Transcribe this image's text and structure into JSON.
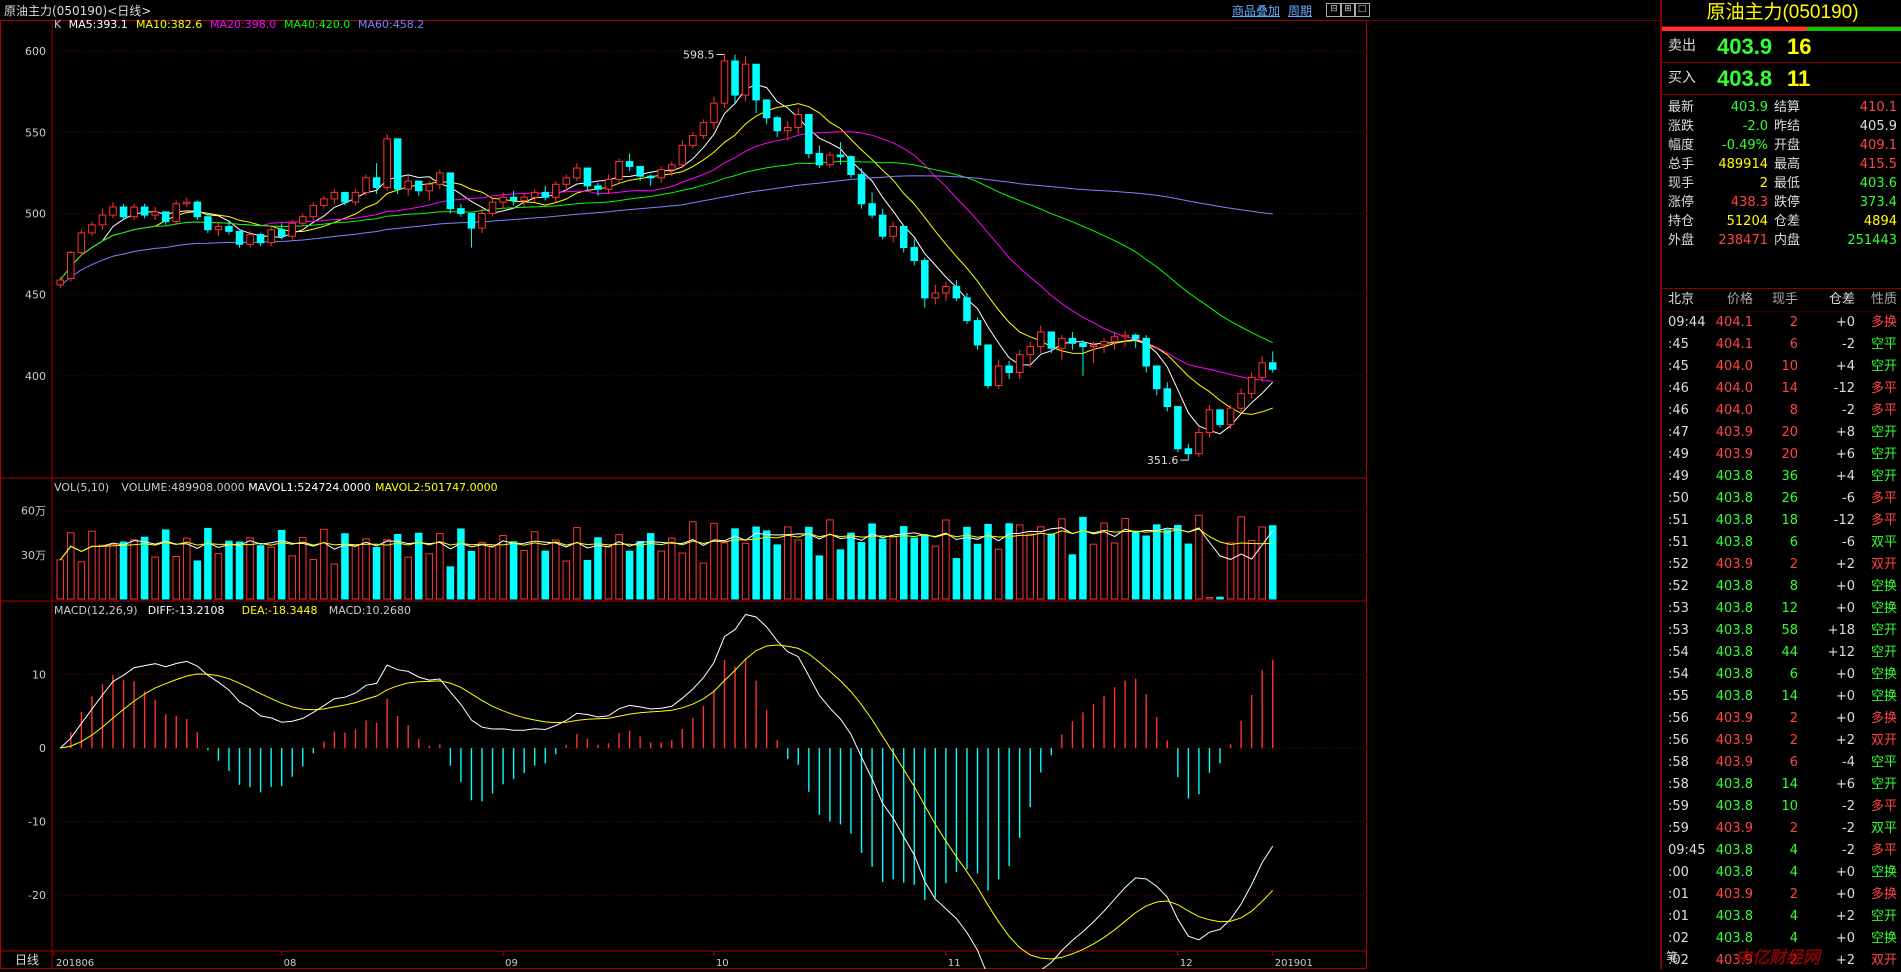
{
  "window": {
    "title": "原油主力(050190)<日线>",
    "links": [
      "商品叠加",
      "周期"
    ],
    "buttons": [
      "⊟",
      "⊞",
      "□"
    ]
  },
  "main_chart": {
    "legend": [
      {
        "label": "K",
        "color": "#cccccc"
      },
      {
        "label": "MA5:393.1",
        "color": "#ffffff"
      },
      {
        "label": "MA10:382.6",
        "color": "#ffff00"
      },
      {
        "label": "MA20:398.0",
        "color": "#ff00ff"
      },
      {
        "label": "MA40:420.0",
        "color": "#00ff00"
      },
      {
        "label": "MA60:458.2",
        "color": "#8080ff"
      }
    ],
    "yticks": [
      "600",
      "550",
      "500",
      "450",
      "400"
    ],
    "high_label": "598.5",
    "low_label": "351.6"
  },
  "volume_chart": {
    "legend": [
      {
        "label": "VOL(5,10)",
        "color": "#cccccc"
      },
      {
        "label": "VOLUME:489908.0000",
        "color": "#cccccc"
      },
      {
        "label": "MAVOL1:524724.0000",
        "color": "#ffffff"
      },
      {
        "label": "MAVOL2:501747.0000",
        "color": "#ffff00"
      }
    ],
    "yticks": [
      "60万",
      "30万"
    ]
  },
  "macd_chart": {
    "legend": [
      {
        "label": "MACD(12,26,9)",
        "color": "#cccccc"
      },
      {
        "label": "DIFF:-13.2108",
        "color": "#ffffff"
      },
      {
        "label": "DEA:-18.3448",
        "color": "#ffff00"
      },
      {
        "label": "MACD:10.2680",
        "color": "#cccccc"
      }
    ],
    "yticks": [
      "10",
      "0",
      "-10",
      "-20"
    ]
  },
  "x_axis": {
    "period_label": "日线",
    "labels": [
      "201806",
      "08",
      "09",
      "10",
      "11",
      "12",
      "201901"
    ]
  },
  "chart_data": {
    "type": "candlestick",
    "title": "原油主力(050190) 日线",
    "ylim": [
      345,
      610
    ],
    "candles": [
      [
        456,
        461,
        454,
        459
      ],
      [
        460,
        477,
        458,
        476
      ],
      [
        476,
        490,
        474,
        488
      ],
      [
        488,
        495,
        486,
        493
      ],
      [
        493,
        503,
        490,
        499
      ],
      [
        499,
        507,
        497,
        504
      ],
      [
        504,
        506,
        496,
        498
      ],
      [
        498,
        506,
        496,
        504
      ],
      [
        504,
        506,
        497,
        499
      ],
      [
        499,
        504,
        496,
        501
      ],
      [
        501,
        501,
        493,
        495
      ],
      [
        495,
        508,
        493,
        506
      ],
      [
        506,
        510,
        504,
        507
      ],
      [
        507,
        508,
        496,
        498
      ],
      [
        498,
        500,
        488,
        490
      ],
      [
        490,
        494,
        486,
        492
      ],
      [
        492,
        496,
        487,
        489
      ],
      [
        489,
        489,
        479,
        481
      ],
      [
        481,
        489,
        479,
        487
      ],
      [
        487,
        488,
        480,
        482
      ],
      [
        482,
        492,
        480,
        490
      ],
      [
        490,
        494,
        484,
        486
      ],
      [
        486,
        496,
        484,
        494
      ],
      [
        494,
        500,
        492,
        498
      ],
      [
        498,
        507,
        496,
        505
      ],
      [
        505,
        511,
        503,
        509
      ],
      [
        509,
        515,
        506,
        513
      ],
      [
        513,
        510,
        505,
        507
      ],
      [
        507,
        515,
        505,
        513
      ],
      [
        513,
        524,
        511,
        522
      ],
      [
        522,
        531,
        512,
        516
      ],
      [
        516,
        549,
        514,
        546
      ],
      [
        546,
        528,
        512,
        515
      ],
      [
        515,
        523,
        511,
        520
      ],
      [
        520,
        519,
        511,
        514
      ],
      [
        514,
        520,
        508,
        518
      ],
      [
        518,
        527,
        515,
        525
      ],
      [
        525,
        515,
        500,
        503
      ],
      [
        503,
        506,
        498,
        500
      ],
      [
        500,
        497,
        479,
        491
      ],
      [
        491,
        503,
        488,
        500
      ],
      [
        500,
        509,
        498,
        507
      ],
      [
        507,
        513,
        503,
        510
      ],
      [
        510,
        514,
        505,
        508
      ],
      [
        508,
        512,
        504,
        510
      ],
      [
        510,
        515,
        507,
        513
      ],
      [
        513,
        517,
        508,
        510
      ],
      [
        510,
        520,
        507,
        518
      ],
      [
        518,
        524,
        514,
        522
      ],
      [
        522,
        531,
        520,
        528
      ],
      [
        528,
        522,
        514,
        517
      ],
      [
        517,
        519,
        511,
        515
      ],
      [
        515,
        524,
        512,
        521
      ],
      [
        521,
        534,
        519,
        532
      ],
      [
        532,
        537,
        526,
        529
      ],
      [
        529,
        528,
        520,
        523
      ],
      [
        523,
        524,
        517,
        522
      ],
      [
        522,
        529,
        519,
        527
      ],
      [
        527,
        532,
        523,
        530
      ],
      [
        530,
        545,
        528,
        542
      ],
      [
        542,
        550,
        540,
        548
      ],
      [
        548,
        558,
        546,
        556
      ],
      [
        556,
        572,
        552,
        568
      ],
      [
        568,
        598,
        565,
        594
      ],
      [
        594,
        598,
        568,
        573
      ],
      [
        573,
        597,
        569,
        592
      ],
      [
        592,
        592,
        562,
        570
      ],
      [
        570,
        568,
        555,
        559
      ],
      [
        559,
        560,
        547,
        551
      ],
      [
        551,
        557,
        545,
        553
      ],
      [
        553,
        565,
        549,
        561
      ],
      [
        561,
        558,
        534,
        537
      ],
      [
        537,
        542,
        528,
        530
      ],
      [
        530,
        538,
        528,
        536
      ],
      [
        536,
        544,
        530,
        535
      ],
      [
        535,
        536,
        522,
        524
      ],
      [
        524,
        528,
        503,
        506
      ],
      [
        506,
        513,
        497,
        499
      ],
      [
        499,
        503,
        484,
        486
      ],
      [
        486,
        495,
        482,
        492
      ],
      [
        492,
        491,
        476,
        479
      ],
      [
        479,
        484,
        468,
        471
      ],
      [
        471,
        473,
        442,
        448
      ],
      [
        448,
        456,
        444,
        451
      ],
      [
        451,
        458,
        446,
        455
      ],
      [
        455,
        459,
        446,
        448
      ],
      [
        448,
        451,
        432,
        434
      ],
      [
        434,
        436,
        416,
        419
      ],
      [
        419,
        419,
        392,
        394
      ],
      [
        394,
        410,
        392,
        406
      ],
      [
        406,
        409,
        398,
        402
      ],
      [
        402,
        416,
        398,
        413
      ],
      [
        413,
        421,
        405,
        418
      ],
      [
        418,
        431,
        414,
        427
      ],
      [
        427,
        426,
        414,
        417
      ],
      [
        417,
        425,
        410,
        423
      ],
      [
        423,
        427,
        416,
        420
      ],
      [
        420,
        422,
        400,
        418
      ],
      [
        418,
        421,
        408,
        419
      ],
      [
        419,
        423,
        414,
        421
      ],
      [
        421,
        427,
        416,
        424
      ],
      [
        424,
        428,
        418,
        425
      ],
      [
        425,
        426,
        417,
        423
      ],
      [
        423,
        425,
        402,
        406
      ],
      [
        406,
        404,
        388,
        392
      ],
      [
        392,
        396,
        378,
        381
      ],
      [
        381,
        375,
        353,
        355
      ],
      [
        355,
        358,
        348,
        352
      ],
      [
        352,
        368,
        350,
        365
      ],
      [
        365,
        382,
        362,
        379
      ],
      [
        379,
        375,
        368,
        370
      ],
      [
        370,
        382,
        367,
        380
      ],
      [
        380,
        392,
        377,
        389
      ],
      [
        389,
        402,
        386,
        399
      ],
      [
        399,
        412,
        396,
        408
      ],
      [
        408,
        415,
        402,
        404
      ]
    ]
  },
  "quote": {
    "name": "原油主力(050190)",
    "sell_label": "卖出",
    "sell_price": "403.9",
    "sell_qty": "16",
    "buy_label": "买入",
    "buy_price": "403.8",
    "buy_qty": "11",
    "stats": [
      {
        "l1": "最新",
        "v1": "403.9",
        "c1": "#3f3",
        "l2": "结算",
        "v2": "410.1",
        "c2": "#f44"
      },
      {
        "l1": "涨跌",
        "v1": "-2.0",
        "c1": "#3f3",
        "l2": "昨结",
        "v2": "405.9",
        "c2": "#ddd"
      },
      {
        "l1": "幅度",
        "v1": "-0.49%",
        "c1": "#3f3",
        "l2": "开盘",
        "v2": "409.1",
        "c2": "#f44"
      },
      {
        "l1": "总手",
        "v1": "489914",
        "c1": "#ff0",
        "l2": "最高",
        "v2": "415.5",
        "c2": "#f44"
      },
      {
        "l1": "现手",
        "v1": "2",
        "c1": "#ff0",
        "l2": "最低",
        "v2": "403.6",
        "c2": "#3f3"
      },
      {
        "l1": "涨停",
        "v1": "438.3",
        "c1": "#f44",
        "l2": "跌停",
        "v2": "373.4",
        "c2": "#3f3"
      },
      {
        "l1": "持仓",
        "v1": "51204",
        "c1": "#ff0",
        "l2": "仓差",
        "v2": "4894",
        "c2": "#ff0"
      },
      {
        "l1": "外盘",
        "v1": "238471",
        "c1": "#f44",
        "l2": "内盘",
        "v2": "251443",
        "c2": "#3f3"
      }
    ],
    "ticks_header": [
      "北京",
      "价格",
      "现手",
      "仓差",
      "性质"
    ],
    "ticks": [
      [
        "09:44",
        "404.1",
        "2",
        "+0",
        "多换"
      ],
      [
        ":45",
        "404.1",
        "6",
        "-2",
        "空平"
      ],
      [
        ":45",
        "404.0",
        "10",
        "+4",
        "空开"
      ],
      [
        ":46",
        "404.0",
        "14",
        "-12",
        "多平"
      ],
      [
        ":46",
        "404.0",
        "8",
        "-2",
        "多平"
      ],
      [
        ":47",
        "403.9",
        "20",
        "+8",
        "空开"
      ],
      [
        ":49",
        "403.9",
        "20",
        "+6",
        "空开"
      ],
      [
        ":49",
        "403.8",
        "36",
        "+4",
        "空开"
      ],
      [
        ":50",
        "403.8",
        "26",
        "-6",
        "多平"
      ],
      [
        ":51",
        "403.8",
        "18",
        "-12",
        "多平"
      ],
      [
        ":51",
        "403.8",
        "6",
        "-6",
        "双平"
      ],
      [
        ":52",
        "403.9",
        "2",
        "+2",
        "双开"
      ],
      [
        ":52",
        "403.8",
        "8",
        "+0",
        "空换"
      ],
      [
        ":53",
        "403.8",
        "12",
        "+0",
        "空换"
      ],
      [
        ":53",
        "403.8",
        "58",
        "+18",
        "空开"
      ],
      [
        ":54",
        "403.8",
        "44",
        "+12",
        "空开"
      ],
      [
        ":54",
        "403.8",
        "6",
        "+0",
        "空换"
      ],
      [
        ":55",
        "403.8",
        "14",
        "+0",
        "空换"
      ],
      [
        ":56",
        "403.9",
        "2",
        "+0",
        "多换"
      ],
      [
        ":56",
        "403.9",
        "2",
        "+2",
        "双开"
      ],
      [
        ":58",
        "403.9",
        "6",
        "-4",
        "空平"
      ],
      [
        ":58",
        "403.8",
        "14",
        "+6",
        "空开"
      ],
      [
        ":59",
        "403.8",
        "10",
        "-2",
        "多平"
      ],
      [
        ":59",
        "403.9",
        "2",
        "-2",
        "双平"
      ],
      [
        "09:45",
        "403.8",
        "4",
        "-2",
        "多平"
      ],
      [
        ":00",
        "403.8",
        "4",
        "+0",
        "空换"
      ],
      [
        ":01",
        "403.9",
        "2",
        "+0",
        "多换"
      ],
      [
        ":01",
        "403.8",
        "4",
        "+2",
        "空开"
      ],
      [
        ":02",
        "403.8",
        "4",
        "+0",
        "空换"
      ],
      [
        ":02",
        "403.9",
        "2",
        "+2",
        "双开"
      ]
    ],
    "bottom_tab": "笔",
    "watermark": "中亿财经网"
  }
}
